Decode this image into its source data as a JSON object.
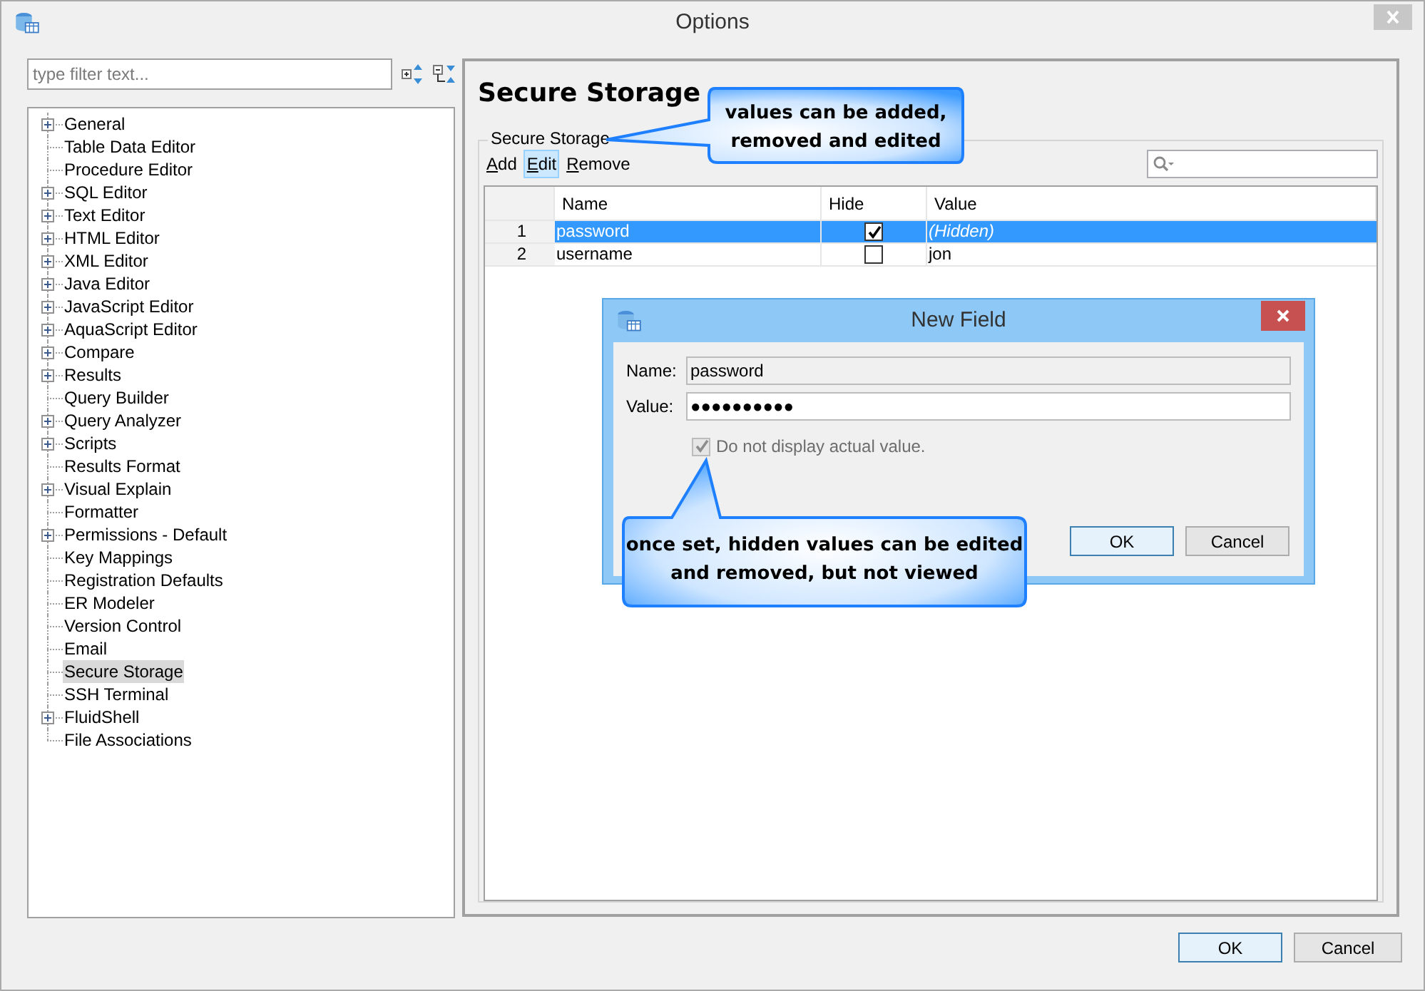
{
  "window": {
    "title": "Options"
  },
  "filter": {
    "placeholder": "type filter text..."
  },
  "tree": {
    "items": [
      {
        "label": "General",
        "expandable": true,
        "selected": false
      },
      {
        "label": "Table Data Editor",
        "expandable": false,
        "selected": false
      },
      {
        "label": "Procedure Editor",
        "expandable": false,
        "selected": false
      },
      {
        "label": "SQL Editor",
        "expandable": true,
        "selected": false
      },
      {
        "label": "Text Editor",
        "expandable": true,
        "selected": false
      },
      {
        "label": "HTML Editor",
        "expandable": true,
        "selected": false
      },
      {
        "label": "XML Editor",
        "expandable": true,
        "selected": false
      },
      {
        "label": "Java Editor",
        "expandable": true,
        "selected": false
      },
      {
        "label": "JavaScript Editor",
        "expandable": true,
        "selected": false
      },
      {
        "label": "AquaScript Editor",
        "expandable": true,
        "selected": false
      },
      {
        "label": "Compare",
        "expandable": true,
        "selected": false
      },
      {
        "label": "Results",
        "expandable": true,
        "selected": false
      },
      {
        "label": "Query Builder",
        "expandable": false,
        "selected": false
      },
      {
        "label": "Query Analyzer",
        "expandable": true,
        "selected": false
      },
      {
        "label": "Scripts",
        "expandable": true,
        "selected": false
      },
      {
        "label": "Results Format",
        "expandable": false,
        "selected": false
      },
      {
        "label": "Visual Explain",
        "expandable": true,
        "selected": false
      },
      {
        "label": "Formatter",
        "expandable": false,
        "selected": false
      },
      {
        "label": "Permissions - Default",
        "expandable": true,
        "selected": false
      },
      {
        "label": "Key Mappings",
        "expandable": false,
        "selected": false
      },
      {
        "label": "Registration Defaults",
        "expandable": false,
        "selected": false
      },
      {
        "label": "ER Modeler",
        "expandable": false,
        "selected": false
      },
      {
        "label": "Version Control",
        "expandable": false,
        "selected": false
      },
      {
        "label": "Email",
        "expandable": false,
        "selected": false
      },
      {
        "label": "Secure Storage",
        "expandable": false,
        "selected": true
      },
      {
        "label": "SSH Terminal",
        "expandable": false,
        "selected": false
      },
      {
        "label": "FluidShell",
        "expandable": true,
        "selected": false
      },
      {
        "label": "File Associations",
        "expandable": false,
        "selected": false
      }
    ]
  },
  "page": {
    "title": "Secure Storage",
    "group_title": "Secure Storage",
    "toolbar": [
      {
        "label": "Add",
        "selected": false
      },
      {
        "label": "Edit",
        "selected": true
      },
      {
        "label": "Remove",
        "selected": false
      }
    ],
    "table": {
      "columns": [
        "Name",
        "Hide",
        "Value"
      ],
      "rows": [
        {
          "number": "1",
          "name": "password",
          "hide": true,
          "value": "(Hidden)",
          "selected": true
        },
        {
          "number": "2",
          "name": "username",
          "hide": false,
          "value": "jon",
          "selected": false
        }
      ]
    }
  },
  "dialog": {
    "title": "New Field",
    "fields": [
      {
        "label": "Name:",
        "value": "password",
        "disabled": true
      },
      {
        "label": "Value:",
        "value": "●●●●●●●●●●",
        "disabled": false
      }
    ],
    "checkbox": {
      "label": "Do not display actual value.",
      "checked": true,
      "disabled": true
    },
    "buttons": [
      {
        "label": "OK",
        "default": true
      },
      {
        "label": "Cancel",
        "default": false
      }
    ]
  },
  "callouts": [
    {
      "text": "values can be added,\nremoved and edited"
    },
    {
      "text": "once set, hidden values can be edited\nand removed, but not viewed"
    }
  ],
  "buttons": [
    {
      "label": "OK",
      "default": true
    },
    {
      "label": "Cancel",
      "default": false
    }
  ]
}
